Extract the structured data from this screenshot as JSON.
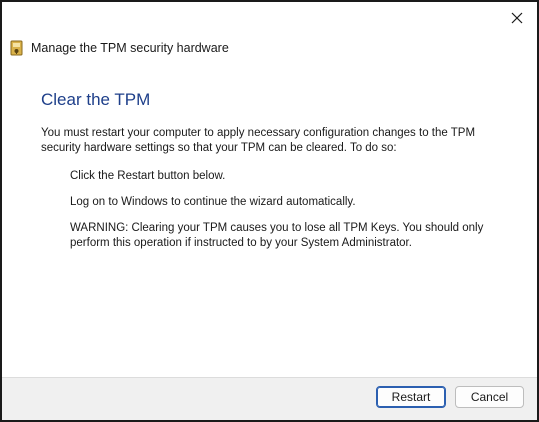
{
  "window": {
    "title": "Manage the TPM security hardware",
    "icon": "tpm-key-icon",
    "close_icon": "close-icon"
  },
  "content": {
    "heading": "Clear the TPM",
    "intro": "You must restart your computer to apply necessary configuration changes to the TPM security hardware settings so that your TPM can be cleared. To do so:",
    "steps": [
      "Click the Restart button below.",
      "Log on to Windows to continue the wizard automatically.",
      "WARNING: Clearing your TPM causes you to lose all TPM Keys. You should only perform this operation if instructed to by your System Administrator."
    ]
  },
  "buttons": {
    "restart": "Restart",
    "cancel": "Cancel"
  },
  "colors": {
    "heading": "#1e3f8a",
    "default_button_border": "#2b5fb0",
    "footer_bg": "#f0f0f0"
  }
}
